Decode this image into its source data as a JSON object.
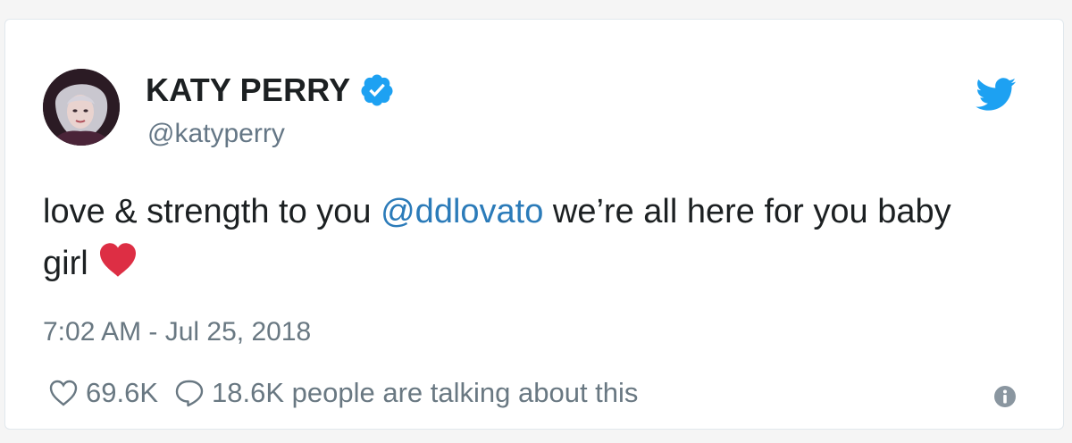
{
  "tweet": {
    "display_name": "KATY PERRY",
    "handle": "@katyperry",
    "text_before": "love & strength to you ",
    "mention": "@ddlovato",
    "text_after": " we’re all here for you baby girl",
    "emoji_icon": "red-heart-icon",
    "timestamp": "7:02 AM - Jul 25, 2018",
    "likes": "69.6K",
    "conversation": "18.6K people are talking about this"
  },
  "icons": {
    "verified": "verified-badge-icon",
    "brand": "twitter-bird-icon",
    "like": "heart-outline-icon",
    "reply": "speech-bubble-icon",
    "info": "info-icon"
  },
  "colors": {
    "brand_blue": "#1da1f2",
    "mention_blue": "#2b7bb9",
    "text": "#1c2022",
    "muted": "#697882",
    "emoji_red": "#dd2e44"
  }
}
